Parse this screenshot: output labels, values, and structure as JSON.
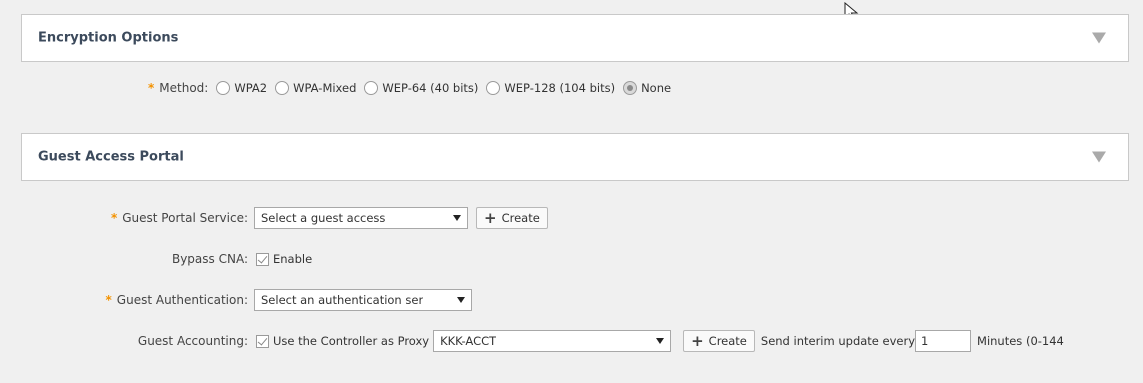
{
  "encryption": {
    "title": "Encryption Options",
    "method_label": "Method:",
    "options": [
      {
        "label": "WPA2",
        "selected": false
      },
      {
        "label": "WPA-Mixed",
        "selected": false
      },
      {
        "label": "WEP-64 (40 bits)",
        "selected": false
      },
      {
        "label": "WEP-128 (104 bits)",
        "selected": false
      },
      {
        "label": "None",
        "selected": true
      }
    ]
  },
  "guest_portal": {
    "title": "Guest Access Portal",
    "service": {
      "label": "Guest Portal Service:",
      "value": "Select a guest access",
      "create_label": "Create"
    },
    "bypass_cna": {
      "label": "Bypass CNA:",
      "checkbox_label": "Enable",
      "checked": true
    },
    "authentication": {
      "label": "Guest Authentication:",
      "value": "Select an authentication ser"
    },
    "accounting": {
      "label": "Guest Accounting:",
      "proxy_label": "Use the Controller as Proxy",
      "proxy_checked": true,
      "server_value": "KKK-ACCT",
      "create_label": "Create",
      "interim_label": "Send interim update every",
      "interim_value": "1",
      "minutes_label": "Minutes (0-144"
    }
  },
  "colors": {
    "required_marker": "#f39200",
    "panel_title": "#3c4a5c",
    "background": "#f0f0f0"
  },
  "icons": {
    "cursor": "pointer-cursor-icon",
    "collapse": "caret-down-icon",
    "add": "plus-icon"
  }
}
